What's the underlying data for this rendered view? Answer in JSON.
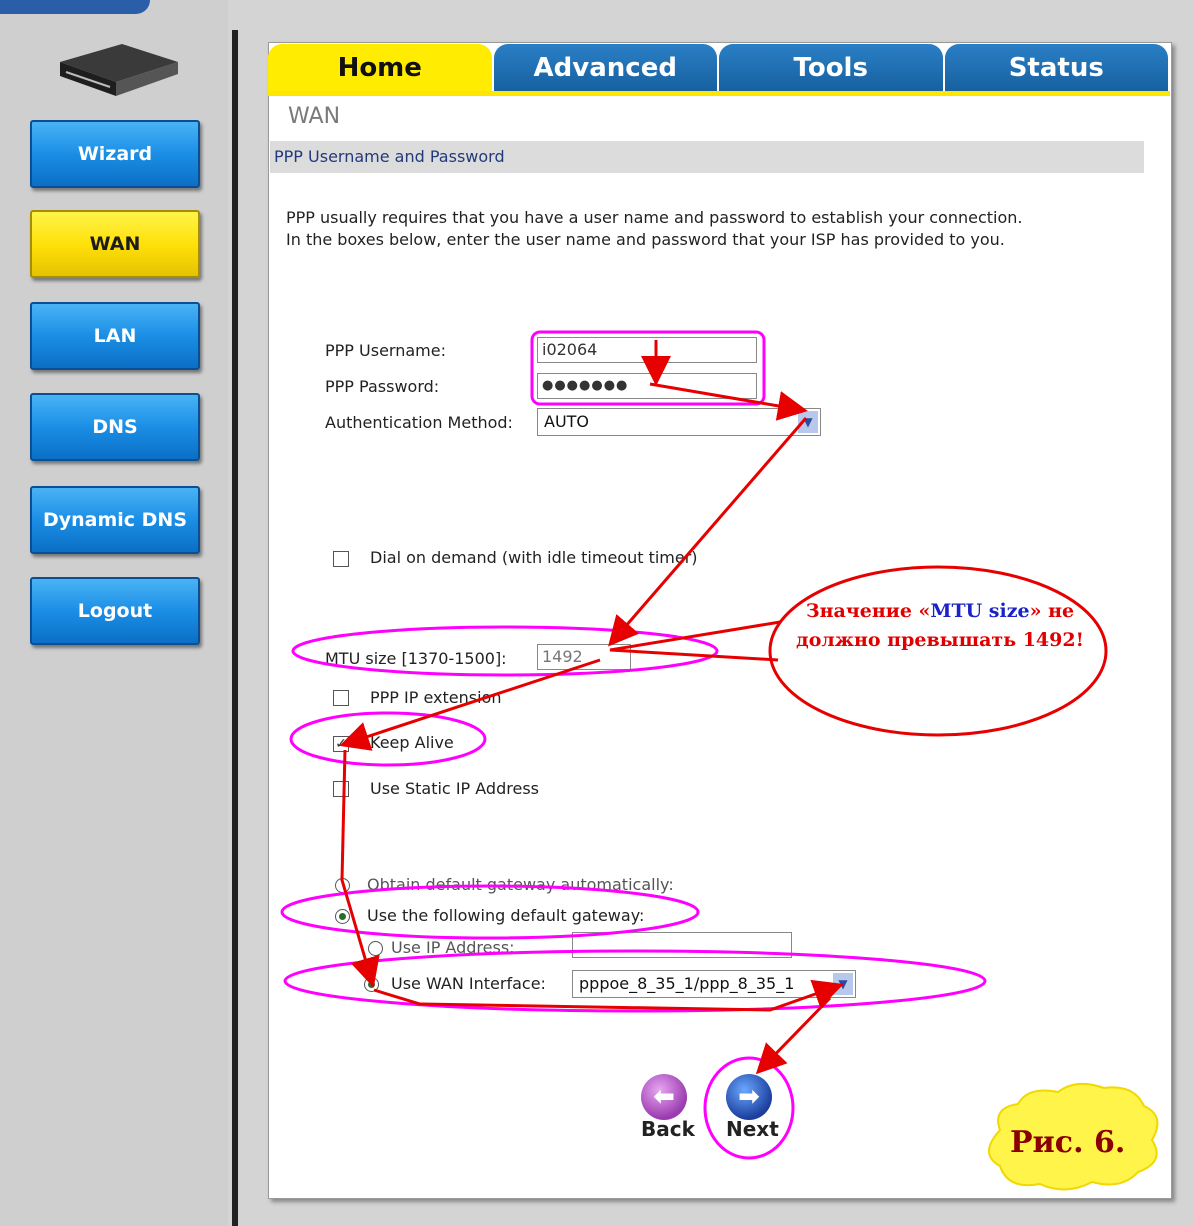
{
  "sidebar": {
    "items": [
      {
        "label": "Wizard",
        "active": false
      },
      {
        "label": "WAN",
        "active": true
      },
      {
        "label": "LAN",
        "active": false
      },
      {
        "label": "DNS",
        "active": false
      },
      {
        "label": "Dynamic DNS",
        "active": false
      },
      {
        "label": "Logout",
        "active": false
      }
    ]
  },
  "tabs": [
    {
      "label": "Home",
      "active": true
    },
    {
      "label": "Advanced",
      "active": false
    },
    {
      "label": "Tools",
      "active": false
    },
    {
      "label": "Status",
      "active": false
    }
  ],
  "page": {
    "title": "WAN",
    "section": "PPP Username and Password",
    "description_line1": "PPP usually requires that you have a user name and password to establish your connection.",
    "description_line2": "In the boxes below, enter the user name and password that your ISP has provided to you."
  },
  "form": {
    "username_label": "PPP Username:",
    "username_value": "i02064",
    "password_label": "PPP Password:",
    "password_value": "●●●●●●●",
    "auth_label": "Authentication Method:",
    "auth_value": "AUTO",
    "dial_on_demand_label": "Dial on demand (with idle timeout timer)",
    "dial_on_demand_checked": false,
    "mtu_label": "MTU size [1370-1500]:",
    "mtu_value": "1492",
    "ppp_ip_ext_label": "PPP IP extension",
    "ppp_ip_ext_checked": false,
    "keep_alive_label": "Keep Alive",
    "keep_alive_checked": true,
    "static_ip_label": "Use Static IP Address",
    "static_ip_checked": false,
    "gw_auto_label": "Obtain default gateway automatically:",
    "gw_manual_label": "Use the following default gateway:",
    "gw_ip_label": "Use IP Address:",
    "gw_ip_value": "",
    "gw_wan_label": "Use WAN Interface:",
    "gw_wan_value": "pppoe_8_35_1/ppp_8_35_1",
    "selected_gateway": "Use the following default gateway",
    "selected_sub": "Use WAN Interface"
  },
  "buttons": {
    "back": "Back",
    "next": "Next"
  },
  "annotation": {
    "note_part1": "Значение «",
    "note_blue": "MTU size",
    "note_part2": "» не должно превышать 1492!",
    "figure_label": "Рис. 6.",
    "callout_color": "#ff00ff",
    "arrow_color": "#e60000"
  }
}
